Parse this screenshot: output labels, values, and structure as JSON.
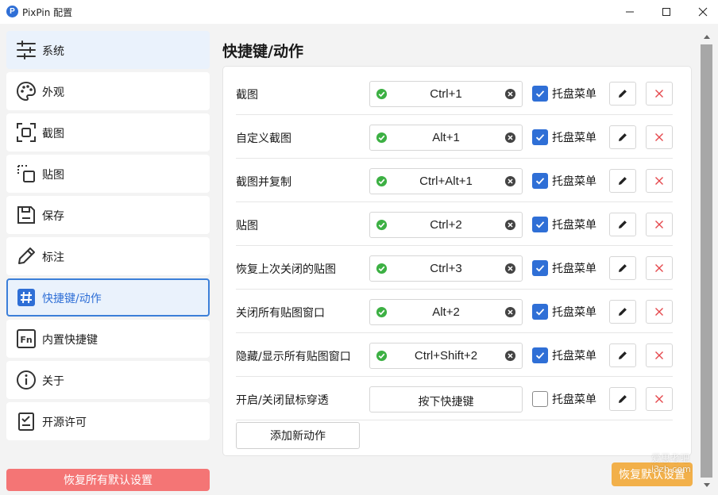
{
  "window": {
    "logo_letter": "P",
    "title": "PixPin 配置"
  },
  "sidebar": {
    "items": [
      {
        "label": "系统",
        "icon": "sliders-icon"
      },
      {
        "label": "外观",
        "icon": "palette-icon"
      },
      {
        "label": "截图",
        "icon": "screenshot-frame-icon"
      },
      {
        "label": "贴图",
        "icon": "pin-image-icon"
      },
      {
        "label": "保存",
        "icon": "save-icon"
      },
      {
        "label": "标注",
        "icon": "pencil-icon"
      },
      {
        "label": "快捷键/动作",
        "icon": "hash-icon"
      },
      {
        "label": "内置快捷键",
        "icon": "fn-key-icon"
      },
      {
        "label": "关于",
        "icon": "info-icon"
      },
      {
        "label": "开源许可",
        "icon": "license-checklist-icon"
      }
    ],
    "active_index": 6,
    "reset_all_label": "恢复所有默认设置"
  },
  "main": {
    "title": "快捷键/动作",
    "rows": [
      {
        "name": "截图",
        "hotkey": "Ctrl+1",
        "valid": true,
        "tray_checked": true
      },
      {
        "name": "自定义截图",
        "hotkey": "Alt+1",
        "valid": true,
        "tray_checked": true
      },
      {
        "name": "截图并复制",
        "hotkey": "Ctrl+Alt+1",
        "valid": true,
        "tray_checked": true
      },
      {
        "name": "贴图",
        "hotkey": "Ctrl+2",
        "valid": true,
        "tray_checked": true
      },
      {
        "name": "恢复上次关闭的贴图",
        "hotkey": "Ctrl+3",
        "valid": true,
        "tray_checked": true
      },
      {
        "name": "关闭所有贴图窗口",
        "hotkey": "Alt+2",
        "valid": true,
        "tray_checked": true
      },
      {
        "name": "隐藏/显示所有贴图窗口",
        "hotkey": "Ctrl+Shift+2",
        "valid": true,
        "tray_checked": true
      },
      {
        "name": "开启/关闭鼠标穿透",
        "hotkey": "按下快捷键",
        "valid": false,
        "tray_checked": false
      }
    ],
    "tray_label": "托盘菜单",
    "add_action_label": "添加新动作",
    "restore_default_label": "恢复默认设置"
  },
  "watermark": {
    "line1": "爱思考吧",
    "line2": "i3zh.com"
  },
  "colors": {
    "accent": "#2f6fd6",
    "success": "#3cb043",
    "danger": "#e5484d",
    "reset_all_bg": "#f47575",
    "restore_default_bg": "#f2b04a"
  }
}
